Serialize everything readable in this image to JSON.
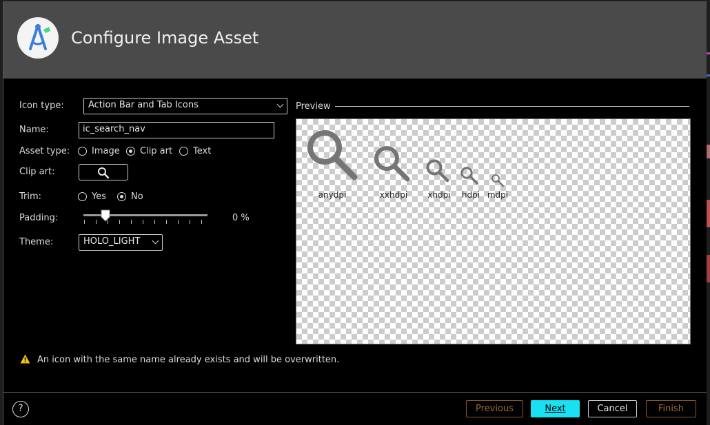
{
  "dialog": {
    "title": "Configure Image Asset"
  },
  "form": {
    "icon_type": {
      "label": "Icon type:",
      "value": "Action Bar and Tab Icons"
    },
    "name": {
      "label": "Name:",
      "value": "ic_search_nav"
    },
    "asset_type": {
      "label": "Asset type:",
      "options": [
        "Image",
        "Clip art",
        "Text"
      ],
      "selected": "Clip art"
    },
    "clip_art": {
      "label": "Clip art:",
      "icon": "search-icon"
    },
    "trim": {
      "label": "Trim:",
      "options": [
        "Yes",
        "No"
      ],
      "selected": "No"
    },
    "padding": {
      "label": "Padding:",
      "value_text": "0 %",
      "value": 0
    },
    "theme": {
      "label": "Theme:",
      "value": "HOLO_LIGHT"
    }
  },
  "preview": {
    "label": "Preview",
    "densities": [
      "anydpi",
      "xxhdpi",
      "xhdpi",
      "hdpi",
      "mdpi"
    ]
  },
  "warning": {
    "text": "An icon with the same name already exists and will be overwritten."
  },
  "footer": {
    "help": "?",
    "previous": "Previous",
    "next": "Next",
    "cancel": "Cancel",
    "finish": "Finish"
  },
  "colors": {
    "accent": "#19e0f2",
    "disabled": "#9e6a33",
    "header": "#4a4a4a"
  }
}
